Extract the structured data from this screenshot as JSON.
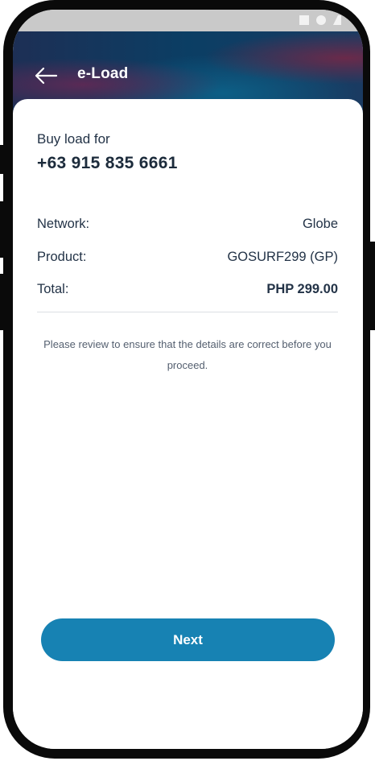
{
  "header": {
    "title": "e-Load"
  },
  "purchase": {
    "buy_label": "Buy load for",
    "phone_number": "+63 915 835 6661"
  },
  "details": {
    "network_label": "Network:",
    "network_value": "Globe",
    "product_label": "Product:",
    "product_value": "GOSURF299 (GP)",
    "total_label": "Total:",
    "total_value": "PHP 299.00"
  },
  "note": "Please review to ensure that the details are correct before you proceed.",
  "actions": {
    "next_label": "Next"
  },
  "colors": {
    "primary_button": "#1782b3",
    "text_dark": "#1c2b3b",
    "header_gradient_start": "#1d2f55",
    "header_gradient_end": "#0b3e64"
  },
  "icons": {
    "back": "arrow-left-icon",
    "status_square": "square-icon",
    "status_circle": "circle-icon"
  }
}
